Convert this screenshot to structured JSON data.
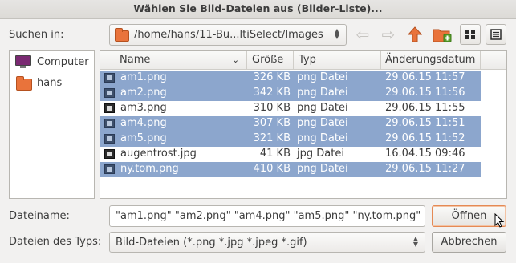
{
  "window": {
    "title": "Wählen Sie Bild-Dateien aus (Bilder-Liste)..."
  },
  "location": {
    "label": "Suchen in:",
    "path": "/home/hans/11-Bu...ltiSelect/Images"
  },
  "toolbar": {
    "back_icon": "arrow-left-icon",
    "forward_icon": "arrow-right-icon",
    "up_icon": "arrow-up-icon",
    "new_folder_icon": "new-folder-icon",
    "icon_view_icon": "grid-view-icon",
    "list_view_icon": "list-view-icon"
  },
  "sidebar": {
    "items": [
      {
        "label": "Computer",
        "icon": "computer-icon"
      },
      {
        "label": "hans",
        "icon": "folder-icon"
      }
    ]
  },
  "file_list": {
    "columns": [
      "Name",
      "Größe",
      "Typ",
      "Änderungsdatum"
    ],
    "sort_indicator": "chevron-down-icon",
    "rows": [
      {
        "name": "am1.png",
        "size": "326 KB",
        "type": "png Datei",
        "date": "29.06.15 11:57",
        "selected": true
      },
      {
        "name": "am2.png",
        "size": "342 KB",
        "type": "png Datei",
        "date": "29.06.15 11:56",
        "selected": true
      },
      {
        "name": "am3.png",
        "size": "310 KB",
        "type": "png Datei",
        "date": "29.06.15 11:55",
        "selected": false
      },
      {
        "name": "am4.png",
        "size": "307 KB",
        "type": "png Datei",
        "date": "29.06.15 11:51",
        "selected": true
      },
      {
        "name": "am5.png",
        "size": "321 KB",
        "type": "png Datei",
        "date": "29.06.15 11:52",
        "selected": true
      },
      {
        "name": "augentrost.jpg",
        "size": "41 KB",
        "type": "jpg Datei",
        "date": "16.04.15 09:46",
        "selected": false
      },
      {
        "name": "ny.tom.png",
        "size": "410 KB",
        "type": "png Datei",
        "date": "29.06.15 11:27",
        "selected": true
      }
    ]
  },
  "filename": {
    "label": "Dateiname:",
    "value": "\"am1.png\" \"am2.png\" \"am4.png\" \"am5.png\" \"ny.tom.png\""
  },
  "filetype": {
    "label": "Dateien des Typs:",
    "value": "Bild-Dateien (*.png *.jpg *.jpeg *.gif)"
  },
  "buttons": {
    "open": "Öffnen",
    "cancel": "Abbrechen"
  },
  "colors": {
    "selection": "#8ca6cd",
    "folder": "#e9733b",
    "up_arrow": "#e9733b",
    "focus_border": "#e58a55"
  }
}
